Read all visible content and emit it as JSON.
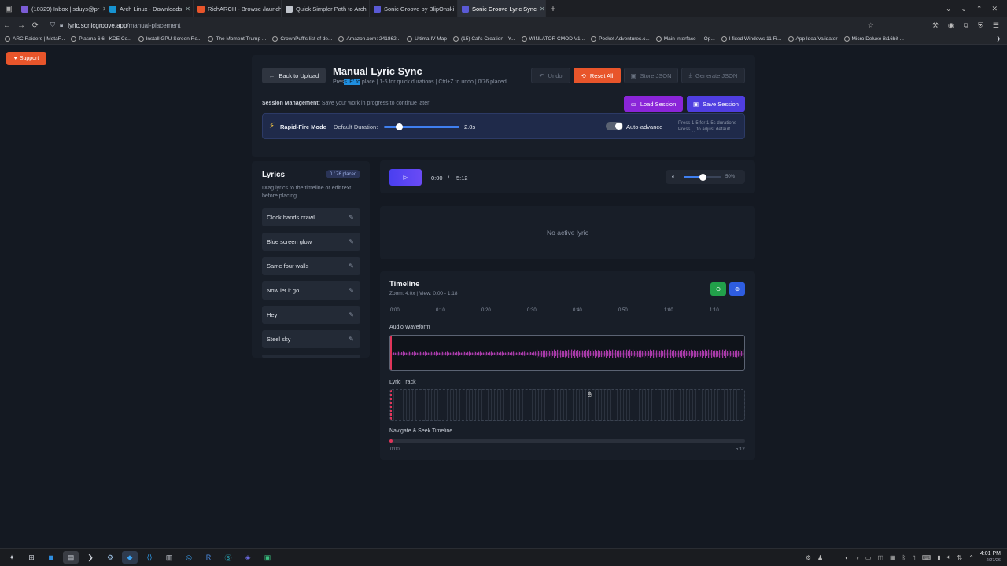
{
  "browser": {
    "tabs": [
      {
        "label": "(10329) Inbox | sduys@pr",
        "color": "#7b5cd6"
      },
      {
        "label": "Arch Linux - Downloads",
        "color": "#1793d1"
      },
      {
        "label": "RichARCH - Browse /launch",
        "color": "#e8552b"
      },
      {
        "label": "Quick Simpler Path to Arch",
        "color": "#c0c4cc"
      },
      {
        "label": "Sonic Groove by BlipOnski",
        "color": "#5a5ad6"
      },
      {
        "label": "Sonic Groove Lyric Sync",
        "color": "#5a5ad6"
      }
    ],
    "url_domain": "lyric.sonicgroove.app",
    "url_path": "/manual-placement",
    "bookmarks": [
      "ARC Raiders | MetaF...",
      "Plasma 6.6 - KDE Co...",
      "Install GPU Screen Re...",
      "The Moment Trump ...",
      "CrownPuff's list of de...",
      "Amazon.com: 241862...",
      "Ultima IV Map",
      "(15) Cal's Creation - Y...",
      "WINLATOR CMOD V1...",
      "Pocket Adventures.c...",
      "Main interface — Op...",
      "I fixed Windows 11 Fi...",
      "App Idea Validator",
      "Micro Deluxe 8/16bit ..."
    ]
  },
  "support_label": "Support",
  "header": {
    "back_label": "Back to Upload",
    "title": "Manual Lyric Sync",
    "subtitle_pre": "Pres",
    "subtitle_hl": "s 'E' to",
    "subtitle_post": " place | 1-5 for quick durations | Ctrl+Z to undo | 0/76 placed",
    "undo_label": "Undo",
    "reset_label": "Reset All",
    "store_label": "Store JSON",
    "generate_label": "Generate JSON",
    "session_bold": "Session Management:",
    "session_text": " Save your work in progress to continue later",
    "load_label": "Load Session",
    "save_label": "Save Session"
  },
  "rapid": {
    "label": "Rapid-Fire Mode",
    "duration_label": "Default Duration:",
    "duration_value": "2.0s",
    "duration_fraction": 0.2,
    "auto_advance_label": "Auto-advance",
    "hint_line1": "Press 1-5 for 1-5s durations",
    "hint_line2": "Press [ ] to adjust default"
  },
  "lyrics": {
    "title": "Lyrics",
    "badge": "0 / 76 placed",
    "desc": "Drag lyrics to the timeline or edit text before placing",
    "items": [
      "Clock hands crawl",
      "Blue screen glow",
      "Same four walls",
      "Now let it go",
      "Hey",
      "Steel sky"
    ]
  },
  "player": {
    "current": "0:00",
    "sep": "/",
    "total": "5:12",
    "volume": "50%",
    "volume_fraction": 0.5
  },
  "active_lyric": "No active lyric",
  "timeline": {
    "title": "Timeline",
    "zoom": "Zoom: 4.0x | View: 0:00 - 1:18",
    "ticks": [
      "0:00",
      "0:10",
      "0:20",
      "0:30",
      "0:40",
      "0:50",
      "1:00",
      "1:10"
    ],
    "waveform_label": "Audio Waveform",
    "lyric_track_label": "Lyric Track",
    "seek_label": "Navigate & Seek Timeline",
    "seek_start": "0:00",
    "seek_end": "5:12"
  },
  "clock": {
    "time": "4:01 PM",
    "date": "2/27/26"
  },
  "colors": {
    "accent": "#4f3ee0",
    "orange": "#e8552b",
    "purple": "#8a25d8",
    "playhead": "#e0355a",
    "waveform": "#a83aa8"
  }
}
